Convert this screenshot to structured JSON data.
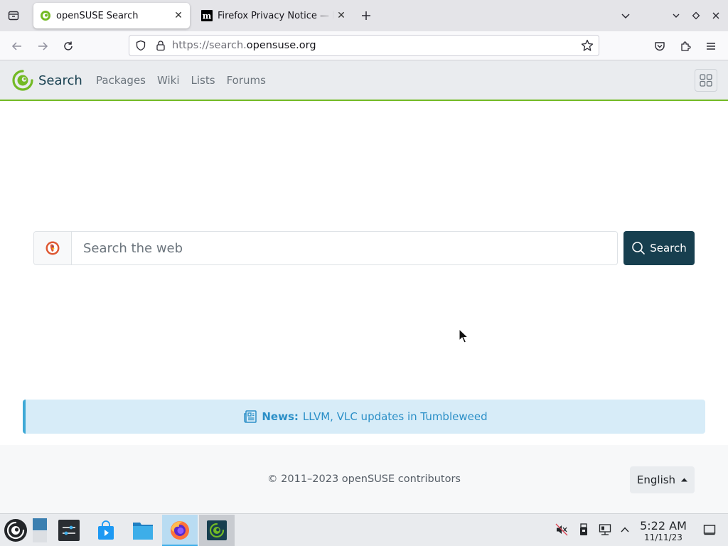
{
  "browser": {
    "tabs": [
      {
        "title": "openSUSE Search",
        "active": true
      },
      {
        "title": "Firefox Privacy Notice — Mozilla",
        "active": false
      }
    ],
    "url": {
      "scheme": "https://search.",
      "host": "opensuse.org"
    }
  },
  "site": {
    "brand": "Search",
    "nav": [
      {
        "label": "Packages"
      },
      {
        "label": "Wiki"
      },
      {
        "label": "Lists"
      },
      {
        "label": "Forums"
      }
    ],
    "search": {
      "placeholder": "Search the web",
      "value": "",
      "button_label": "Search",
      "engine_icon": "duckduckgo-icon"
    },
    "news": {
      "label": "News:",
      "text": "LLVM, VLC updates in Tumbleweed"
    },
    "footer": {
      "copyright": "© 2011–2023 openSUSE contributors",
      "language": "English"
    }
  },
  "taskbar": {
    "time": "5:22 AM",
    "date": "11/11/23"
  },
  "colors": {
    "brand_dark": "#173f4f",
    "accent_green": "#73ba25",
    "news_bg": "#d7ecf8",
    "news_text": "#2b8fc7"
  }
}
